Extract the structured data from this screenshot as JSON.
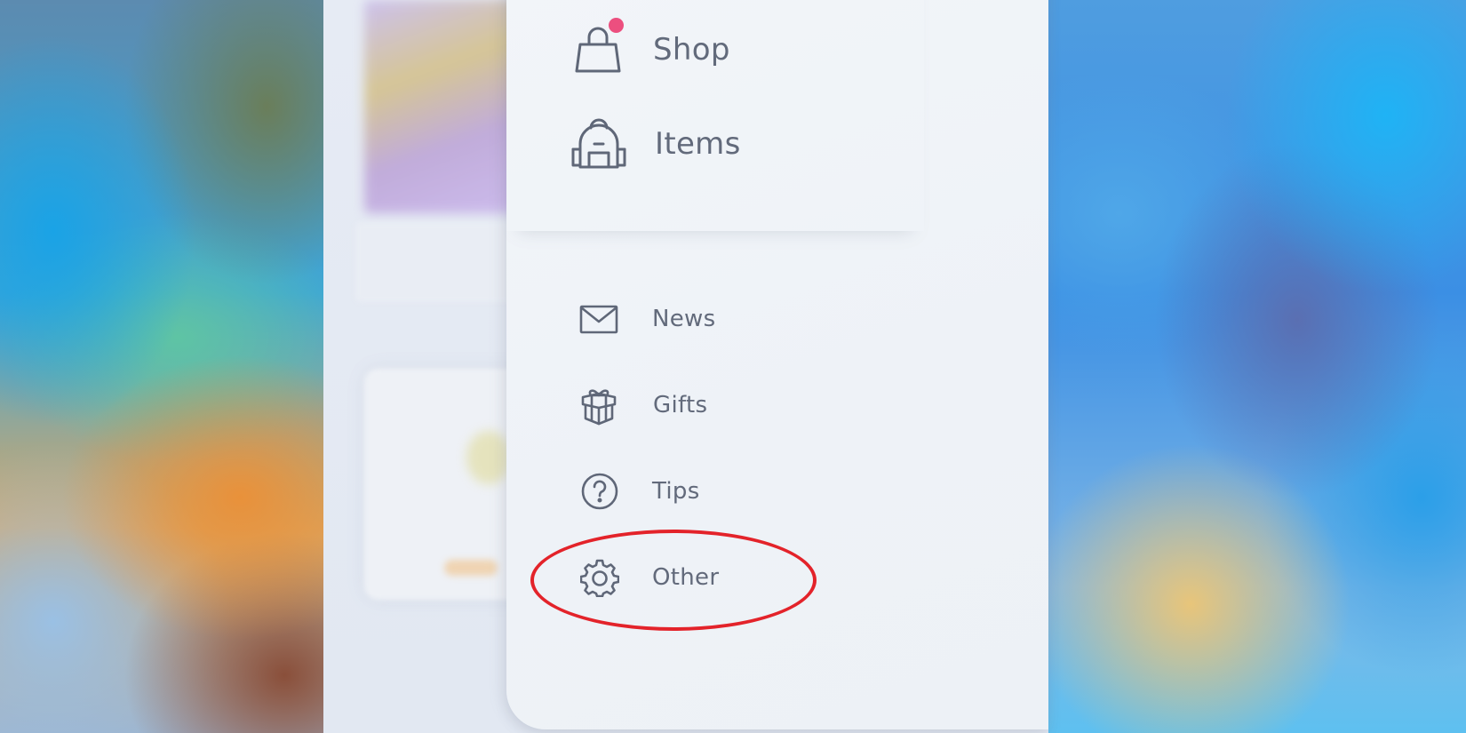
{
  "background": {
    "left_colors": [
      "#1aa3e6",
      "#e9913a",
      "#5ec4a4",
      "#8a4f3a"
    ],
    "right_colors": [
      "#1fb3f5",
      "#5a6fb2",
      "#e8c57a",
      "#2b9fe8"
    ]
  },
  "menu": {
    "primary_items": [
      {
        "label": "Shop",
        "icon": "shopping-bag-icon",
        "has_notification": true
      },
      {
        "label": "Items",
        "icon": "backpack-icon",
        "has_notification": false
      }
    ],
    "secondary_items": [
      {
        "label": "News",
        "icon": "envelope-icon"
      },
      {
        "label": "Gifts",
        "icon": "gift-icon"
      },
      {
        "label": "Tips",
        "icon": "question-circle-icon"
      },
      {
        "label": "Other",
        "icon": "gear-icon",
        "highlighted": true
      }
    ],
    "notification_color": "#ec4f7f",
    "highlight_color": "#e3232a",
    "text_color": "#626a7b"
  }
}
